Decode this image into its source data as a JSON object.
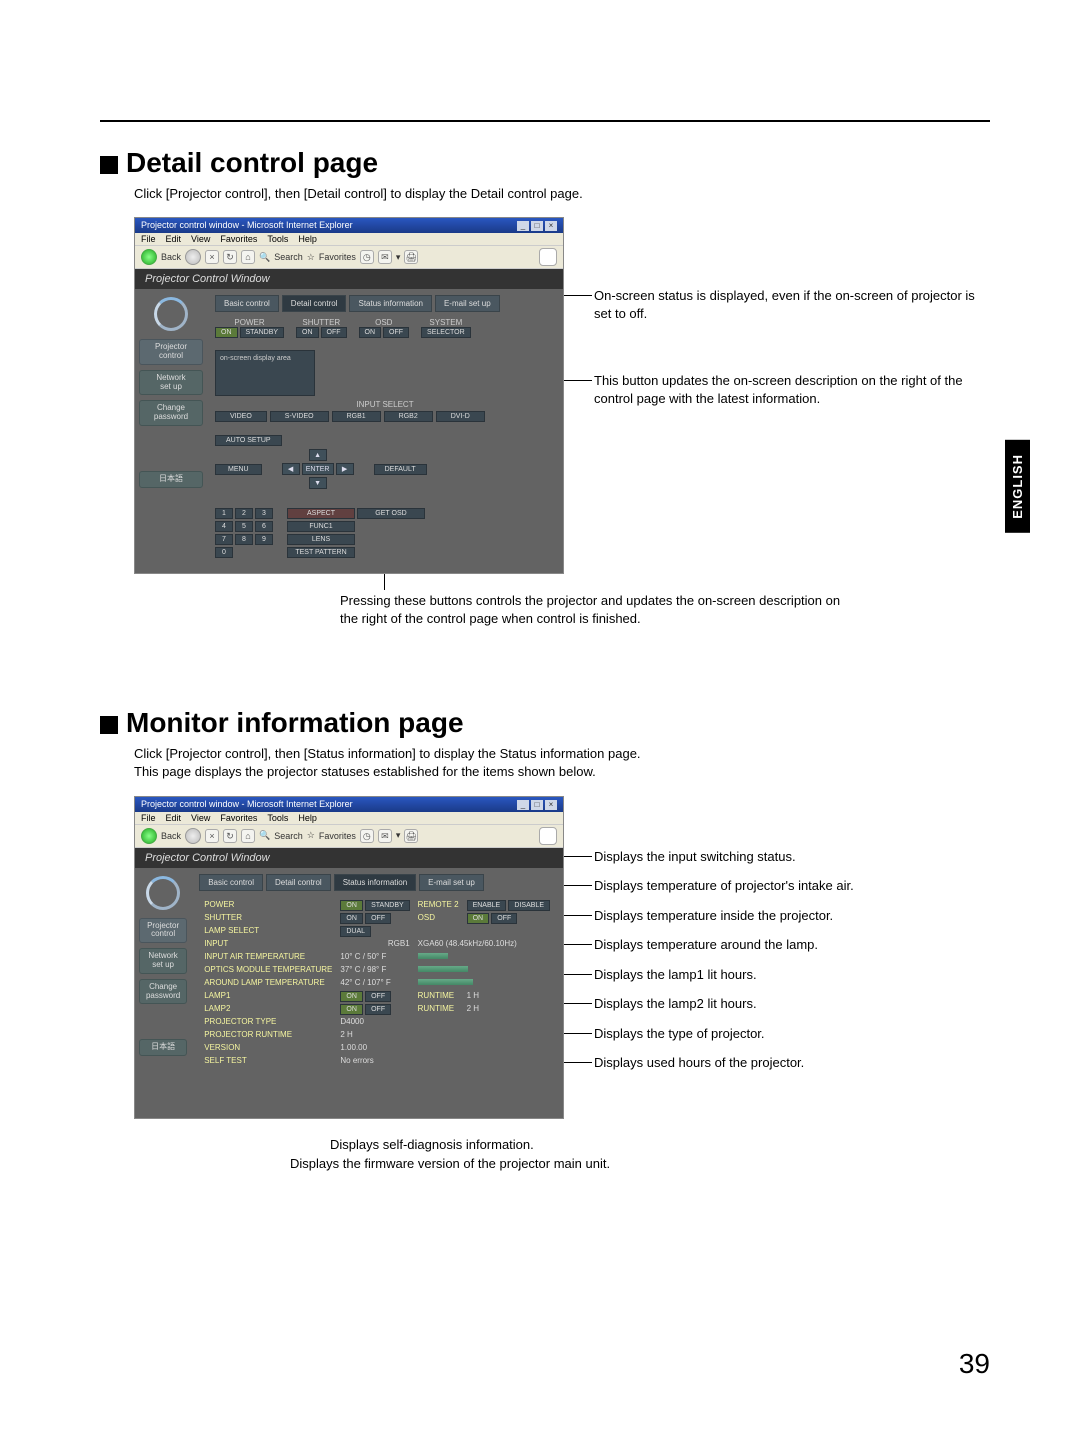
{
  "page_number": "39",
  "side_tab": "ENGLISH",
  "section1": {
    "title": "Detail control page",
    "intro": "Click [Projector control], then [Detail control] to display the Detail control page.",
    "anno1": "On-screen status is displayed, even if the on-screen of projector is set to off.",
    "anno2": "This button updates the on-screen description on the right of the control page with the latest information.",
    "below": "Pressing these buttons controls the projector and updates the on-screen description on the right of the control page when control is finished."
  },
  "section2": {
    "title": "Monitor information page",
    "intro": "Click [Projector control], then [Status information] to display the Status information page.\nThis page displays the projector statuses established for the items shown below.",
    "a1": "Displays the input switching status.",
    "a2": "Displays temperature of projector's intake air.",
    "a3": "Displays temperature inside the projector.",
    "a4": "Displays temperature around the lamp.",
    "a5": "Displays the lamp1 lit hours.",
    "a6": "Displays the lamp2 lit hours.",
    "a7": "Displays the type of projector.",
    "a8": "Displays used hours of the projector.",
    "b1": "Displays self-diagnosis information.",
    "b2": "Displays the firmware version of the projector main unit."
  },
  "browser": {
    "title": "Projector control window - Microsoft Internet Explorer",
    "menu": {
      "file": "File",
      "edit": "Edit",
      "view": "View",
      "fav": "Favorites",
      "tools": "Tools",
      "help": "Help"
    },
    "toolbar": {
      "back": "Back",
      "search": "Search",
      "favorites": "Favorites"
    },
    "pcw_header": "Projector Control Window",
    "sidebar": {
      "projector_control": "Projector\ncontrol",
      "network": "Network\nset up",
      "change_pw": "Change\npassword",
      "jp": "日本語"
    },
    "tabs": {
      "basic": "Basic control",
      "detail": "Detail control",
      "status": "Status information",
      "email": "E-mail set up"
    }
  },
  "detail": {
    "power": "POWER",
    "on": "ON",
    "standby": "STANDBY",
    "shutter": "SHUTTER",
    "off": "OFF",
    "osd": "OSD",
    "system": "SYSTEM",
    "selector": "SELECTOR",
    "input_select": "INPUT SELECT",
    "video": "VIDEO",
    "svideo": "S-VIDEO",
    "rgb1": "RGB1",
    "rgb2": "RGB2",
    "dvid": "DVI-D",
    "auto": "AUTO SETUP",
    "menu": "MENU",
    "enter": "ENTER",
    "default": "DEFAULT",
    "aspect": "ASPECT",
    "get_osd": "GET OSD",
    "func1": "FUNC1",
    "lens": "LENS",
    "test": "TEST PATTERN",
    "osd_box": "on-screen display area"
  },
  "status": {
    "rows": {
      "power": "POWER",
      "on": "ON",
      "standby": "STANDBY",
      "remote2": "REMOTE 2",
      "enable": "ENABLE",
      "disable": "DISABLE",
      "shutter": "SHUTTER",
      "off": "OFF",
      "osd": "OSD",
      "lamp_select": "LAMP SELECT",
      "dual": "DUAL",
      "input": "INPUT",
      "input_v": "RGB1",
      "input_res": "XGA60 (48.45kHz/60.10Hz)",
      "air": "INPUT AIR TEMPERATURE",
      "air_v": "10° C / 50° F",
      "optics": "OPTICS MODULE TEMPERATURE",
      "optics_v": "37° C / 98° F",
      "around": "AROUND LAMP TEMPERATURE",
      "around_v": "42° C / 107° F",
      "lamp1": "LAMP1",
      "runtime": "RUNTIME",
      "l1_v": "1 H",
      "lamp2": "LAMP2",
      "l2_v": "2 H",
      "ptype": "PROJECTOR TYPE",
      "ptype_v": "D4000",
      "prun": "PROJECTOR RUNTIME",
      "prun_v": "2 H",
      "ver": "VERSION",
      "ver_v": "1.00.00",
      "self": "SELF TEST",
      "self_v": "No errors"
    }
  }
}
